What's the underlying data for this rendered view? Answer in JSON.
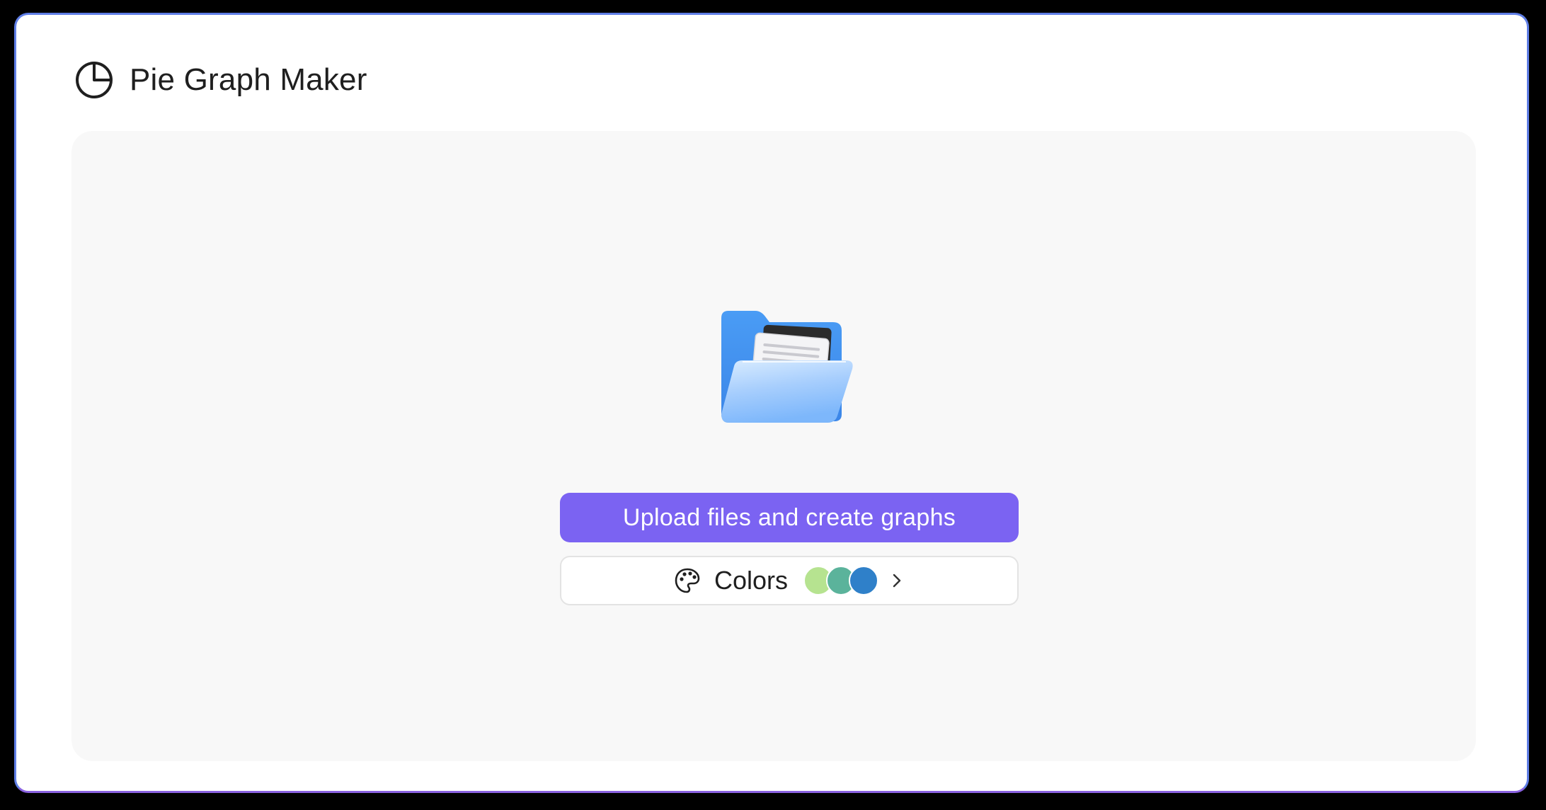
{
  "app": {
    "title": "Pie Graph Maker",
    "icon": "pie-chart-icon"
  },
  "dropzone": {
    "illustration": "open-folder-icon",
    "upload_label": "Upload files and create graphs",
    "colors_label": "Colors",
    "colors_icon": "palette-icon",
    "chevron_icon": "chevron-right-icon",
    "swatches": [
      "#b6e390",
      "#5bb39b",
      "#2f80c9"
    ]
  },
  "theme": {
    "accent": "#7b63f2",
    "panel_bg": "#f8f8f8"
  }
}
